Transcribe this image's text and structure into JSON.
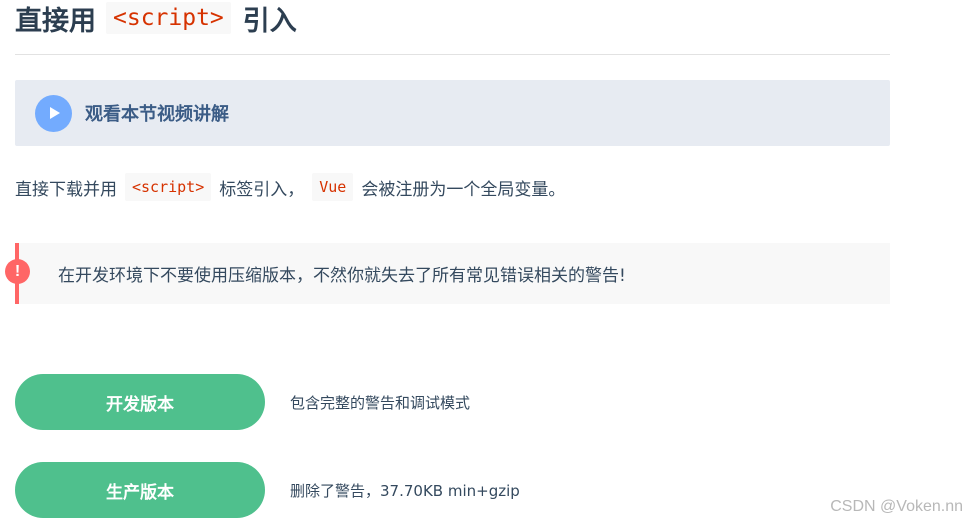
{
  "heading": {
    "prefix": "直接用",
    "code": "<script>",
    "suffix": "引入"
  },
  "video_banner": {
    "label": "观看本节视频讲解",
    "icon": "play-icon"
  },
  "intro": {
    "text1": "直接下载并用",
    "code1": "<script>",
    "text2": "标签引入，",
    "code2": "Vue",
    "text3": "会被注册为一个全局变量。"
  },
  "warning": {
    "icon_glyph": "!",
    "text": "在开发环境下不要使用压缩版本，不然你就失去了所有常见错误相关的警告!"
  },
  "downloads": [
    {
      "label": "开发版本",
      "description": "包含完整的警告和调试模式"
    },
    {
      "label": "生产版本",
      "description": "删除了警告，37.70KB min+gzip"
    }
  ],
  "watermark": "CSDN @Voken.nn",
  "colors": {
    "accent_green": "#4fc08d",
    "warning_red": "#ff6666",
    "code_red": "#d63200",
    "play_blue": "#73abfe",
    "banner_bg": "#e7ebf2"
  }
}
